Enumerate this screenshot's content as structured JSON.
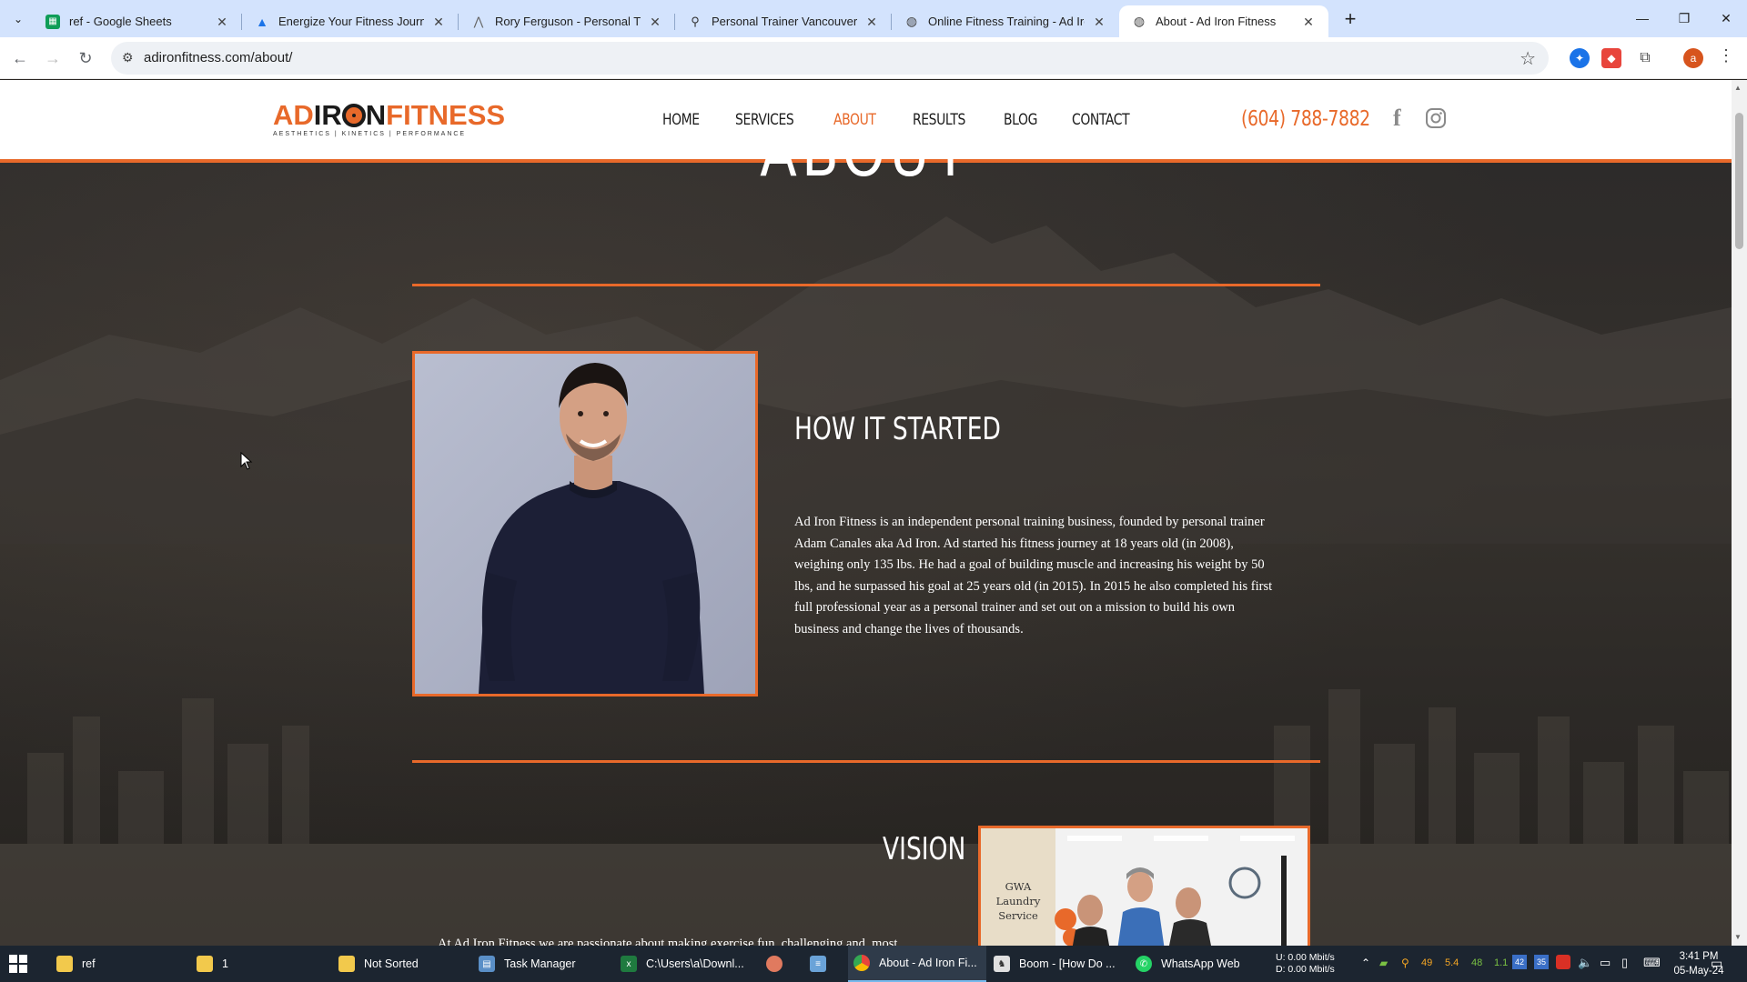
{
  "browser": {
    "tabs": [
      {
        "title": "ref - Google Sheets",
        "icon": "google-sheets-icon",
        "color": "#0f9d58"
      },
      {
        "title": "Energize Your Fitness Journey w",
        "icon": "mountain-logo-icon",
        "color": "#1a73e8"
      },
      {
        "title": "Rory Ferguson - Personal Trainin",
        "icon": "chart-logo-icon",
        "color": "#666666"
      },
      {
        "title": "Personal Trainer Vancouver | We",
        "icon": "trainer-logo-icon",
        "color": "#333333"
      },
      {
        "title": "Online Fitness Training - Ad Iron",
        "icon": "globe-icon",
        "color": "#444444"
      },
      {
        "title": "About - Ad Iron Fitness",
        "icon": "globe-icon",
        "color": "#444444"
      }
    ],
    "url": "adironfitness.com/about/"
  },
  "site": {
    "logo": {
      "part1": "AD",
      "part2": "IR",
      "part3": "N",
      "part4": "FITNESS",
      "tagline": "AESTHETICS | KINETICS | PERFORMANCE"
    },
    "nav": [
      "HOME",
      "SERVICES",
      "ABOUT",
      "RESULTS",
      "BLOG",
      "CONTACT"
    ],
    "active_nav": "ABOUT",
    "phone": "(604) 788-7882",
    "accent": "#e8692a"
  },
  "content": {
    "heading": "ABOUT",
    "how_title": "HOW IT STARTED",
    "how_lines": [
      "Ad Iron Fitness is an independent personal training business, founded by personal trainer",
      "Adam Canales aka Ad Iron. Ad started his fitness journey at 18 years old (in 2008),",
      "weighing only 135 lbs. He had a goal of building muscle and increasing his weight by 50",
      "lbs, and he surpassed his goal at 25 years old (in 2015). In 2015 he also completed his first",
      "full professional year as a personal trainer and set out on a mission to build his own",
      "business and change the lives of thousands."
    ],
    "vision_title": "VISION",
    "vision_partial": "At Ad Iron Fitness we are passionate about making exercise fun, challenging and, most",
    "gym_sign": "GWA Laundry Service"
  },
  "taskbar": {
    "items": [
      {
        "label": "ref",
        "icon": "folder-icon",
        "color": "#f2c94c"
      },
      {
        "label": "1",
        "icon": "folder-icon",
        "color": "#f2c94c"
      },
      {
        "label": "Not Sorted",
        "icon": "folder-icon",
        "color": "#f2c94c"
      },
      {
        "label": "Task Manager",
        "icon": "task-manager-icon",
        "color": "#5a8fc7"
      },
      {
        "label": "C:\\Users\\a\\Downl...",
        "icon": "excel-icon",
        "color": "#1f7a3f"
      },
      {
        "label": "",
        "icon": "app-icon",
        "color": "#e07a5f"
      },
      {
        "label": "",
        "icon": "notepad-icon",
        "color": "#6aa3d8"
      },
      {
        "label": "About - Ad Iron Fi...",
        "icon": "chrome-icon",
        "color": "#e8453c"
      },
      {
        "label": "Boom - [How Do ...",
        "icon": "boom-icon",
        "color": "#e0e0e0"
      },
      {
        "label": "WhatsApp Web",
        "icon": "whatsapp-icon",
        "color": "#25d366"
      }
    ],
    "net_upload": "U:  0.00 Mbit/s",
    "net_download": "D:  0.00 Mbit/s",
    "tray_numbers": [
      "49",
      "5.4",
      "48",
      "1.1"
    ],
    "tray_badges": [
      "42",
      "35"
    ],
    "time": "3:41 PM",
    "date": "05-May-24"
  }
}
